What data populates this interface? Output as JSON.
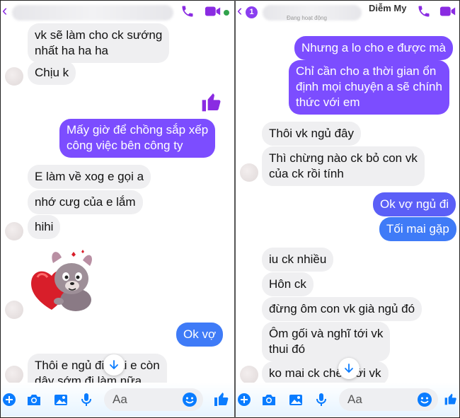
{
  "colors": {
    "accent": "#8a2be2",
    "messenger_blue": "#0a7cff",
    "incoming_bubble": "#efeff1"
  },
  "left_panel": {
    "header": {
      "icons": [
        "chevron-left-icon",
        "phone-icon",
        "video-icon"
      ]
    },
    "messages": [
      {
        "side": "in",
        "text_lines": [
          "vk sẽ làm cho ck sướng",
          "nhất ha ha ha"
        ]
      },
      {
        "side": "in",
        "text_lines": [
          "Chịu k"
        ]
      },
      {
        "side": "out",
        "text_lines": [
          "Mấy giờ để chồng sắp xếp",
          "công việc bên công ty"
        ]
      },
      {
        "side": "in",
        "text_lines": [
          "E làm về xog e gọi a"
        ]
      },
      {
        "side": "in",
        "text_lines": [
          "nhớ cưg của e lắm"
        ]
      },
      {
        "side": "in",
        "text_lines": [
          "hihi"
        ]
      },
      {
        "side": "out",
        "text_lines": [
          "Ok vợ"
        ]
      },
      {
        "side": "in",
        "text_lines": [
          "Thôi e ngủ đi mai e còn",
          "dây sớm đi làm nữa"
        ]
      }
    ],
    "sticker": "dog-with-heart-sticker",
    "composer": {
      "placeholder": "Aa"
    }
  },
  "right_panel": {
    "header": {
      "back_badge": "1",
      "contact_name": "Diễm My",
      "status_text": "Đang hoạt động",
      "icons": [
        "chevron-left-icon",
        "phone-icon",
        "video-icon"
      ]
    },
    "messages": [
      {
        "side": "out",
        "text_lines": [
          "Nhưng a lo cho e được mà"
        ]
      },
      {
        "side": "out",
        "text_lines": [
          "Chỉ cần cho a thời gian ổn",
          "định mọi chuyện a sẽ chính",
          "thức với em"
        ]
      },
      {
        "side": "in",
        "text_lines": [
          "Thôi vk ngủ đây"
        ]
      },
      {
        "side": "in",
        "text_lines": [
          "Thì chừng nào ck bỏ con vk",
          "của ck rồi tính"
        ]
      },
      {
        "side": "out",
        "text_lines": [
          "Ok vợ ngủ đi"
        ]
      },
      {
        "side": "out",
        "text_lines": [
          "Tối mai gặp"
        ]
      },
      {
        "side": "in",
        "text_lines": [
          "iu ck nhiều"
        ]
      },
      {
        "side": "in",
        "text_lines": [
          "Hôn ck"
        ]
      },
      {
        "side": "in",
        "text_lines": [
          "đừng ôm con vk già ngủ đó"
        ]
      },
      {
        "side": "in",
        "text_lines": [
          "Ôm gối và nghĩ tới vk",
          "thui đó"
        ]
      },
      {
        "side": "in",
        "text_lines": [
          "ko mai ck chết với vk"
        ]
      }
    ],
    "composer": {
      "placeholder": "Aa"
    }
  }
}
